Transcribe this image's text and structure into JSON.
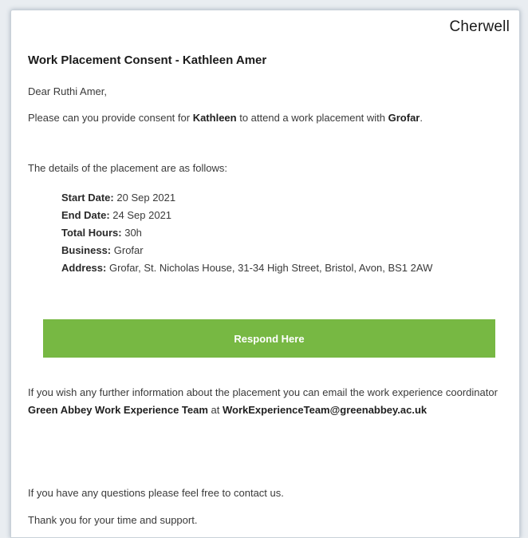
{
  "brand": "Cherwell",
  "email": {
    "subject": "Work Placement Consent - Kathleen Amer",
    "greeting": "Dear Ruthi Amer,",
    "consent": {
      "prefix": "Please can you provide consent for ",
      "student": "Kathleen",
      "middle": " to attend a work placement with ",
      "business": "Grofar",
      "suffix": "."
    },
    "details_intro": "The details of the placement are as follows:",
    "details": [
      {
        "label": "Start Date:",
        "value": "20 Sep 2021"
      },
      {
        "label": "End Date:",
        "value": "24 Sep 2021"
      },
      {
        "label": "Total Hours:",
        "value": "30h"
      },
      {
        "label": "Business:",
        "value": "Grofar"
      },
      {
        "label": "Address:",
        "value": "Grofar, St. Nicholas House, 31-34 High Street, Bristol, Avon, BS1 2AW"
      }
    ],
    "respond_label": "Respond Here",
    "info": {
      "prefix": "If you wish any further information about the placement you can email the work experience coordinator ",
      "team": "Green Abbey Work Experience Team",
      "middle": " at ",
      "email": "WorkExperienceTeam@greenabbey.ac.uk"
    },
    "questions": "If you have any questions please feel free to contact us.",
    "thanks": "Thank you for your time and support."
  },
  "colors": {
    "button": "#77b843",
    "background": "#e9edf1"
  }
}
